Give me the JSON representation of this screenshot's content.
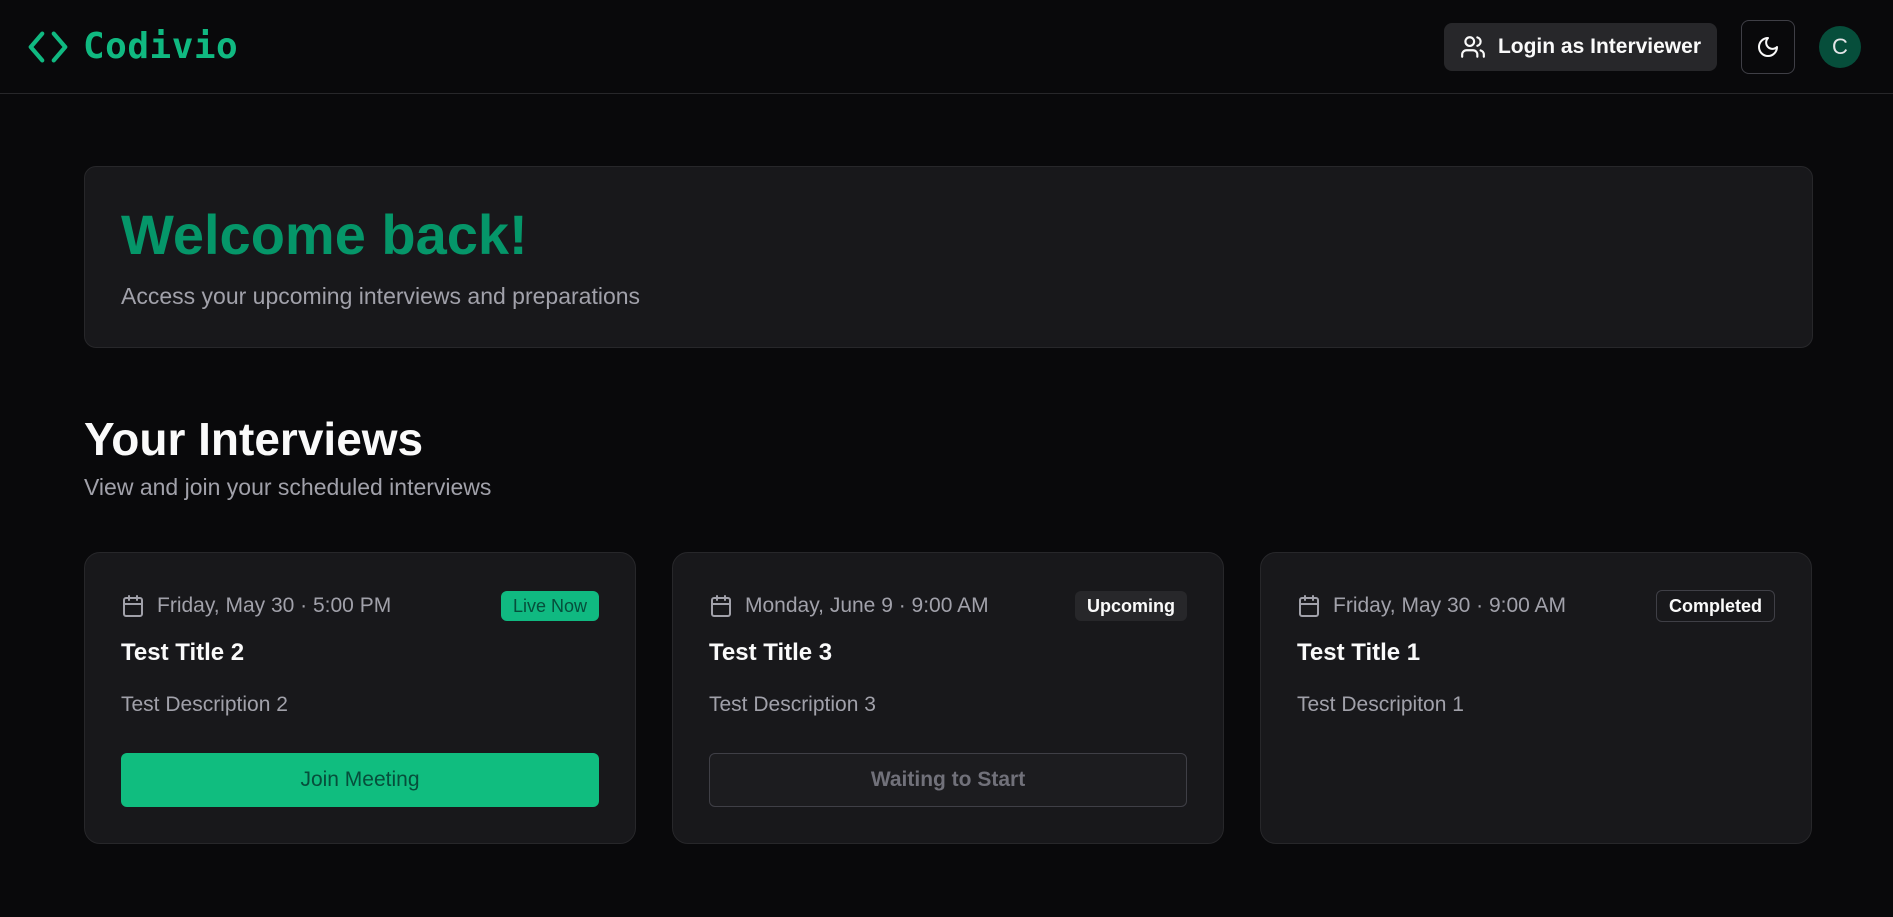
{
  "brand": {
    "name": "Codivio",
    "icon": "code-brackets-icon"
  },
  "header": {
    "login_label": "Login as Interviewer",
    "login_icon": "users-icon",
    "theme_icon": "moon-icon",
    "avatar_initial": "C"
  },
  "welcome": {
    "title": "Welcome back!",
    "subtitle": "Access your upcoming interviews and preparations"
  },
  "interviews": {
    "title": "Your Interviews",
    "subtitle": "View and join your scheduled interviews",
    "cards": [
      {
        "date": "Friday, May 30 · 5:00 PM",
        "status": "Live Now",
        "title": "Test Title 2",
        "description": "Test Description 2",
        "action": "Join Meeting"
      },
      {
        "date": "Monday, June 9 · 9:00 AM",
        "status": "Upcoming",
        "title": "Test Title 3",
        "description": "Test Description 3",
        "action": "Waiting to Start"
      },
      {
        "date": "Friday, May 30 · 9:00 AM",
        "status": "Completed",
        "title": "Test Title 1",
        "description": "Test Descripiton 1"
      }
    ]
  },
  "colors": {
    "accent": "#10b981",
    "accent_dark": "#059669",
    "background": "#09090b",
    "card": "#18181b"
  }
}
